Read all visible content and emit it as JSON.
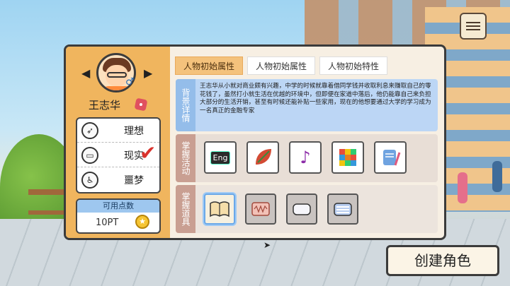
{
  "character": {
    "name": "王志华",
    "gender_symbol": "♂"
  },
  "traits": [
    {
      "label": "理想",
      "icon": "rocket-icon"
    },
    {
      "label": "现实",
      "icon": "car-icon"
    },
    {
      "label": "噩梦",
      "icon": "wheelchair-icon"
    }
  ],
  "points": {
    "header": "可用点数",
    "value": "10PT"
  },
  "tabs": [
    {
      "label": "人物初始属性",
      "active": true
    },
    {
      "label": "人物初始属性",
      "active": false
    },
    {
      "label": "人物初始特性",
      "active": false
    }
  ],
  "sections": {
    "background": {
      "label": "背景详情",
      "text": "王志华从小就对商业颇有兴趣，中学的时候就靠着借同学钱并收取利息来赚取自己的零花钱了，虽然打小就生活在优越的环境中，但即便在家道中落后，他仍能靠自己来负担大部分的生活开销，甚至有时候还能补贴一些家用，现在的他想要通过大学的学习成为一名真正的金融专家"
    },
    "activities": {
      "label": "掌握活动",
      "items": [
        {
          "icon": "eng-icon",
          "text": "Eng"
        },
        {
          "icon": "leaf-icon"
        },
        {
          "icon": "music-note-icon"
        },
        {
          "icon": "rubiks-cube-icon"
        },
        {
          "icon": "scroll-quill-icon"
        }
      ]
    },
    "items": {
      "label": "掌握道具",
      "items": [
        {
          "icon": "book-icon",
          "selected": true
        },
        {
          "icon": "fabric-icon"
        },
        {
          "icon": "pillow-icon"
        },
        {
          "icon": "striped-mat-icon"
        }
      ]
    }
  },
  "create_button": "创建角色",
  "colors": {
    "panel_left": "#f0b55e",
    "accent_tab": "#f4c27c",
    "section_blue": "#94bdea",
    "section_brown": "#c99f92",
    "check_red": "#d9322c"
  }
}
